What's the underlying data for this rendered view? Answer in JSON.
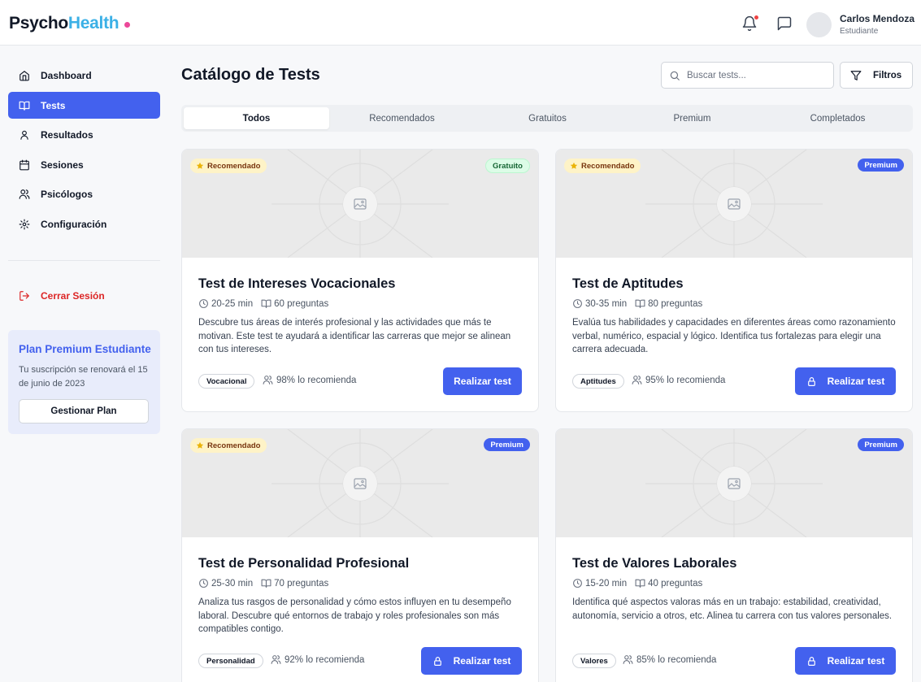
{
  "app": {
    "logo_part1": "Psycho",
    "logo_part2": "Health",
    "accent_color": "#4361ee",
    "logo_accent_color": "#3bb0e6"
  },
  "header": {
    "notification_icon": "bell-icon",
    "messages_icon": "message-square-icon",
    "user_name": "Carlos Mendoza",
    "user_role": "Estudiante"
  },
  "sidebar": {
    "items": [
      {
        "label": "Dashboard",
        "icon": "home-icon"
      },
      {
        "label": "Tests",
        "icon": "book-open-icon"
      },
      {
        "label": "Resultados",
        "icon": "user-icon"
      },
      {
        "label": "Sesiones",
        "icon": "calendar-icon"
      },
      {
        "label": "Psicólogos",
        "icon": "users-icon"
      },
      {
        "label": "Configuración",
        "icon": "gear-icon"
      }
    ],
    "logout_label": "Cerrar Sesión",
    "premium": {
      "title": "Plan Premium Estudiante",
      "text": "Tu suscripción se renovará el 15 de junio de 2023",
      "button_label": "Gestionar Plan"
    }
  },
  "main": {
    "title": "Catálogo de Tests",
    "search_placeholder": "Buscar tests...",
    "filters_label": "Filtros",
    "tabs": [
      {
        "label": "Todos"
      },
      {
        "label": "Recomendados"
      },
      {
        "label": "Gratuitos"
      },
      {
        "label": "Premium"
      },
      {
        "label": "Completados"
      }
    ]
  },
  "tests": [
    {
      "title": "Test de Intereses Vocacionales",
      "recommended_badge": "Recomendado",
      "access_badge": "Gratuito",
      "duration": "20-25 min",
      "questions": "60 preguntas",
      "description": "Descubre tus áreas de interés profesional y las actividades que más te motivan. Este test te ayudará a identificar las carreras que mejor se alinean con tus intereses.",
      "category": "Vocacional",
      "recommend_rate": "98% lo recomienda",
      "cta_label": "Realizar test"
    },
    {
      "title": "Test de Aptitudes",
      "recommended_badge": "Recomendado",
      "access_badge": "Premium",
      "duration": "30-35 min",
      "questions": "80 preguntas",
      "description": "Evalúa tus habilidades y capacidades en diferentes áreas como razonamiento verbal, numérico, espacial y lógico. Identifica tus fortalezas para elegir una carrera adecuada.",
      "category": "Aptitudes",
      "recommend_rate": "95% lo recomienda",
      "cta_label": "Realizar test"
    },
    {
      "title": "Test de Personalidad Profesional",
      "recommended_badge": "Recomendado",
      "access_badge": "Premium",
      "duration": "25-30 min",
      "questions": "70 preguntas",
      "description": "Analiza tus rasgos de personalidad y cómo estos influyen en tu desempeño laboral. Descubre qué entornos de trabajo y roles profesionales son más compatibles contigo.",
      "category": "Personalidad",
      "recommend_rate": "92% lo recomienda",
      "cta_label": "Realizar test"
    },
    {
      "title": "Test de Valores Laborales",
      "access_badge": "Premium",
      "duration": "15-20 min",
      "questions": "40 preguntas",
      "description": "Identifica qué aspectos valoras más en un trabajo: estabilidad, creatividad, autonomía, servicio a otros, etc. Alinea tu carrera con tus valores personales.",
      "category": "Valores",
      "recommend_rate": "85% lo recomienda",
      "cta_label": "Realizar test"
    }
  ]
}
